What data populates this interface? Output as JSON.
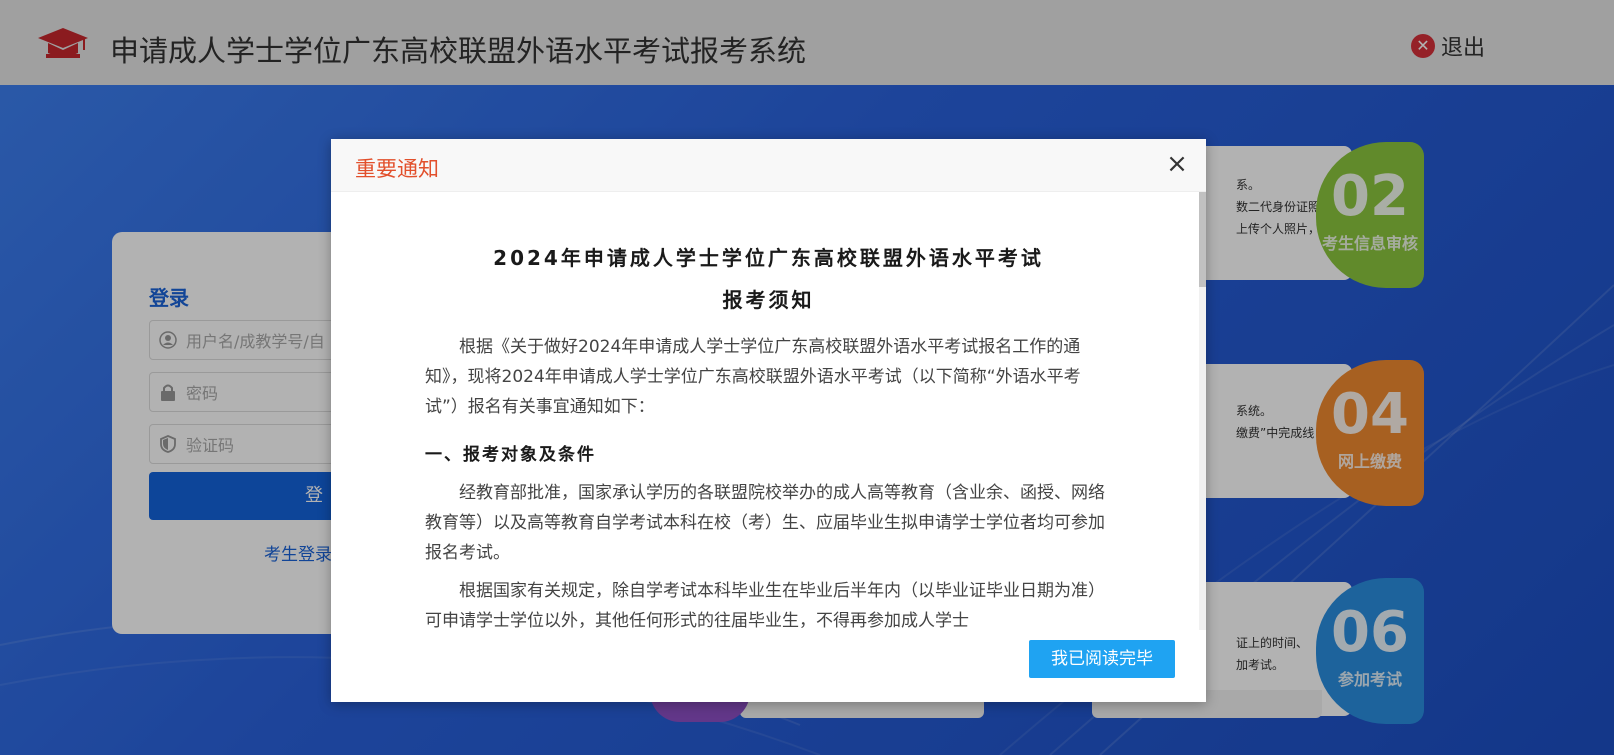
{
  "header": {
    "title": "申请成人学士学位广东高校联盟外语水平考试报考系统",
    "logout_label": "退出",
    "logo_icon": "graduation-cap-icon"
  },
  "login": {
    "title": "登录",
    "username_placeholder": "用户名/成教学号/自",
    "password_placeholder": "密码",
    "captcha_placeholder": "验证码",
    "submit_label": "登",
    "link_label": "考生登录"
  },
  "steps": [
    {
      "num": "02",
      "label": "考生信息审核",
      "lines": [
        "系。",
        "数二代身份证照片。",
        "上传个人照片，完"
      ],
      "color": "#8cc63e"
    },
    {
      "num": "04",
      "label": "网上缴费",
      "lines": [
        "系统。",
        "缴费”中完成线"
      ],
      "color": "#f08a30"
    },
    {
      "num": "06",
      "label": "参加考试",
      "lines": [
        "证上的时间、",
        "加考试。"
      ],
      "color": "#2a8fe0"
    }
  ],
  "modal": {
    "title": "重要通知",
    "close_icon": "close-icon",
    "doc_title_1": "2024年申请成人学士学位广东高校联盟外语水平考试",
    "doc_title_2": "报考须知",
    "para1": "根据《关于做好2024年申请成人学士学位广东高校联盟外语水平考试报名工作的通知》，现将2024年申请成人学士学位广东高校联盟外语水平考试（以下简称“外语水平考试”）报名有关事宜通知如下：",
    "section1": "一、报考对象及条件",
    "para2": "经教育部批准，国家承认学历的各联盟院校举办的成人高等教育（含业余、函授、网络教育等）以及高等教育自学考试本科在校（考）生、应届毕业生拟申请学士学位者均可参加报名考试。",
    "para3": "根据国家有关规定，除自学考试本科毕业生在毕业后半年内（以毕业证毕业日期为准）可申请学士学位以外，其他任何形式的往届毕业生，不得再参加成人学士",
    "confirm_label": "我已阅读完毕"
  }
}
